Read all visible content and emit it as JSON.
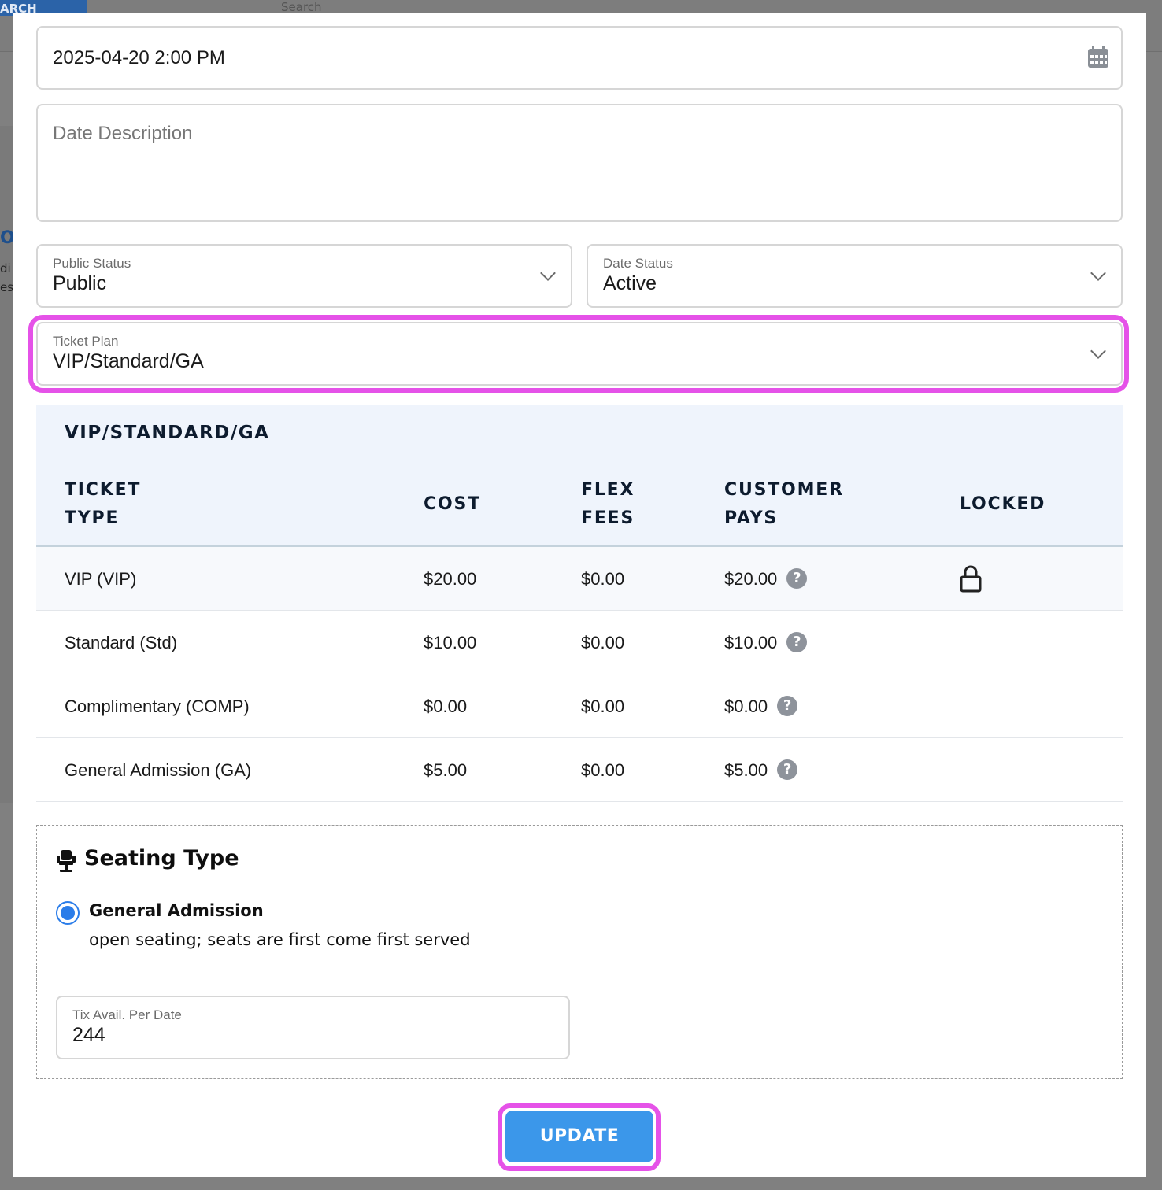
{
  "background": {
    "search_button": "ARCH",
    "search_placeholder": "Search",
    "side_letter": "O",
    "side_text_1": "di",
    "side_text_2": "es"
  },
  "datetime": {
    "value": "2025-04-20 2:00 PM",
    "icon": "calendar-icon"
  },
  "description": {
    "placeholder": "Date Description",
    "value": ""
  },
  "public_status": {
    "label": "Public Status",
    "value": "Public"
  },
  "date_status": {
    "label": "Date Status",
    "value": "Active"
  },
  "ticket_plan": {
    "label": "Ticket Plan",
    "value": "VIP/Standard/GA"
  },
  "plan_table": {
    "title": "VIP/STANDARD/GA",
    "headers": {
      "ticket_type_1": "TICKET",
      "ticket_type_2": "TYPE",
      "cost": "COST",
      "flex_1": "FLEX",
      "flex_2": "FEES",
      "pays_1": "CUSTOMER",
      "pays_2": "PAYS",
      "locked": "LOCKED"
    },
    "rows": [
      {
        "type": "VIP (VIP)",
        "cost": "$20.00",
        "flex": "$0.00",
        "pays": "$20.00",
        "locked": true
      },
      {
        "type": "Standard (Std)",
        "cost": "$10.00",
        "flex": "$0.00",
        "pays": "$10.00",
        "locked": false
      },
      {
        "type": "Complimentary (COMP)",
        "cost": "$0.00",
        "flex": "$0.00",
        "pays": "$0.00",
        "locked": false
      },
      {
        "type": "General Admission (GA)",
        "cost": "$5.00",
        "flex": "$0.00",
        "pays": "$5.00",
        "locked": false
      }
    ],
    "help_glyph": "?"
  },
  "seating": {
    "title": "Seating Type",
    "option_label": "General Admission",
    "option_desc": "open seating; seats are first come first served",
    "tix_label": "Tix Avail. Per Date",
    "tix_value": "244"
  },
  "update_label": "UPDATE",
  "colors": {
    "accent": "#3b97ea",
    "highlight": "#e552e8",
    "radio": "#2b7de9",
    "table_header_bg": "#eff4fc"
  }
}
